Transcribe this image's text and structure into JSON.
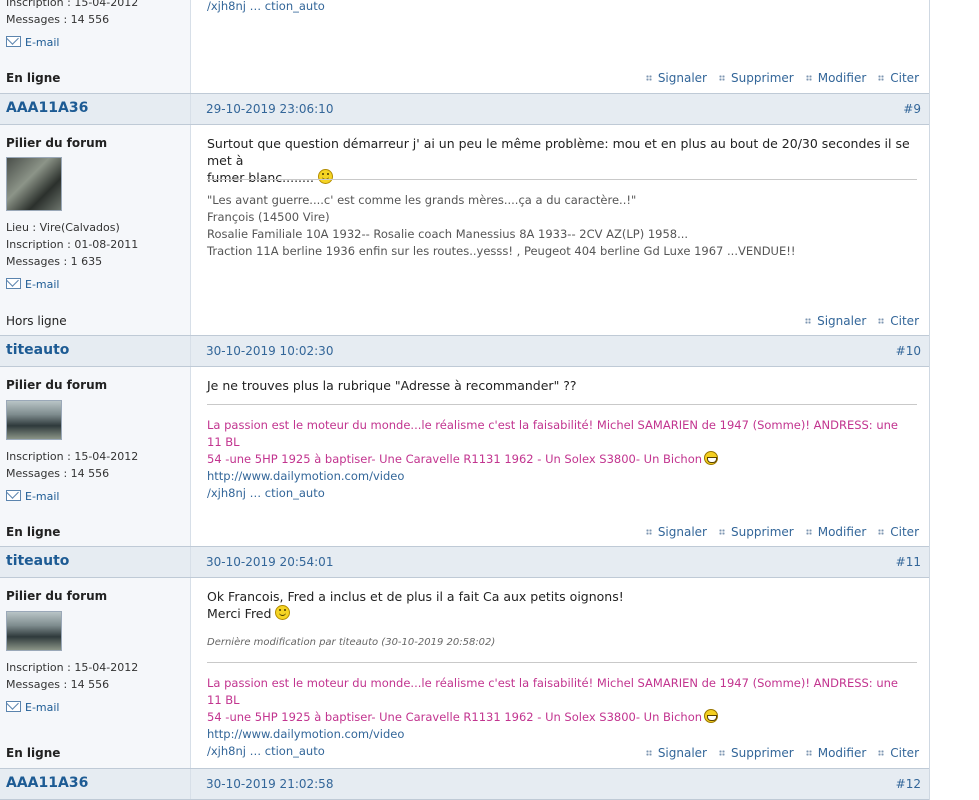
{
  "actions": {
    "signaler": "Signaler",
    "supprimer": "Supprimer",
    "modifier": "Modifier",
    "citer": "Citer"
  },
  "email_label": "E-mail",
  "top_partial": {
    "inscription": "Inscription : 15-04-2012",
    "messages": "Messages : 14 556",
    "status": "En ligne",
    "sig_tail": "/xjh8nj … ction_auto"
  },
  "posts": [
    {
      "author": "AAA11A36",
      "date": "29-10-2019 23:06:10",
      "number": "#9",
      "rank": "Pilier du forum",
      "lieu": "Lieu : Vire(Calvados)",
      "inscription": "Inscription : 01-08-2011",
      "messages": "Messages : 1 635",
      "status": "Hors ligne",
      "body_line1": "Surtout que question démarreur j' ai un peu le même problème: mou et en plus au bout de 20/30 secondes il se met à",
      "body_line2": "fumer blanc........",
      "sig": [
        "\"Les avant guerre....c' est comme les grands mères....ça a du caractère..!\"",
        "François (14500 Vire)",
        "Rosalie Familiale 10A 1932-- Rosalie coach Manessius 8A 1933-- 2CV AZ(LP) 1958...",
        "Traction 11A berline 1936  enfin sur les routes..yesss! , Peugeot 404 berline Gd Luxe 1967 ...VENDUE!!"
      ]
    },
    {
      "author": "titeauto",
      "date": "30-10-2019 10:02:30",
      "number": "#10",
      "rank": "Pilier du forum",
      "inscription": "Inscription : 15-04-2012",
      "messages": "Messages : 14 556",
      "status": "En ligne",
      "body_line1": "Je ne trouves plus la rubrique \"Adresse à recommander\" ??",
      "sig_line1": "La passion est le moteur du monde...le réalisme c'est la faisabilité! Michel  SAMARIEN de 1947 (Somme)! ANDRESS: une 11 BL",
      "sig_line2a": "54 -une 5HP 1925 à baptiser- Une Caravelle R1131 1962 - Un Solex S3800- Un Bichon",
      "sig_link": "http://www.dailymotion.com/video",
      "sig_line3": "/xjh8nj … ction_auto"
    },
    {
      "author": "titeauto",
      "date": "30-10-2019 20:54:01",
      "number": "#11",
      "rank": "Pilier du forum",
      "inscription": "Inscription : 15-04-2012",
      "messages": "Messages : 14 556",
      "status": "En ligne",
      "body_line1": "Ok Francois, Fred a inclus et de plus il a fait Ca aux petits oignons!",
      "body_line2": "Merci Fred",
      "edit": "Dernière modification par titeauto (30-10-2019 20:58:02)",
      "sig_line1": "La passion est le moteur du monde...le réalisme c'est la faisabilité! Michel  SAMARIEN de 1947 (Somme)! ANDRESS: une 11 BL",
      "sig_line2a": "54 -une 5HP 1925 à baptiser- Une Caravelle R1131 1962 - Un Solex S3800- Un Bichon",
      "sig_link": "http://www.dailymotion.com/video",
      "sig_line3": "/xjh8nj … ction_auto"
    },
    {
      "author": "AAA11A36",
      "date": "30-10-2019 21:02:58",
      "number": "#12"
    }
  ]
}
